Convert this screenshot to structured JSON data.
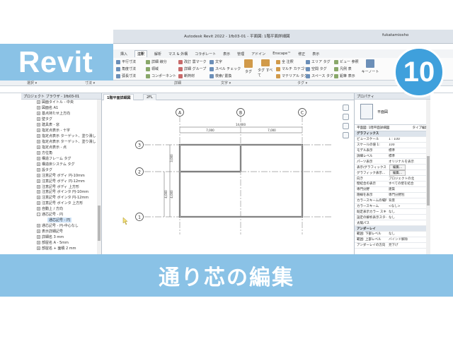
{
  "overlay": {
    "brand_label": "Revit",
    "episode_number": "10",
    "caption": "通り芯の編集"
  },
  "window": {
    "title": "Autodesk Revit 2022 - 1fb03-01 - 平面図: 1階平面詳細図",
    "user": "fukatamiosho"
  },
  "ribbon": {
    "tabs": [
      "挿入",
      "注釈",
      "解析",
      "マス & 外構",
      "コラボレート",
      "表示",
      "管理",
      "アドイン",
      "Enscape™",
      "修正",
      "表示"
    ],
    "active_tab_index": 1,
    "groups": {
      "dimension": [
        "平行寸法",
        "角度寸法",
        "弧長寸法"
      ],
      "detail": [
        "詳細 線分",
        "領域",
        "コンポーネント"
      ],
      "detail2": [
        "改訂 雲マーク",
        "詳細 グループ",
        "断熱材"
      ],
      "text": [
        "文字",
        "スペル チェック",
        "検索/ 置換"
      ],
      "tag": [
        "タグ",
        "タグ すべて"
      ],
      "tag2": [
        "全 注釈",
        "マルチ カテゴリ",
        "マテリアル タグ"
      ],
      "tag3": [
        "エリア タグ",
        "空間 タグ",
        "スペース タグ"
      ],
      "symbol": [
        "ビュー 参照",
        "凡例 表",
        "鉛筆 表示"
      ],
      "keynote": "キーノート"
    },
    "panel_labels": [
      "選択 ▾",
      "寸法 ▾",
      "詳細",
      "文字 ▾",
      "タグ ▾"
    ]
  },
  "project_browser": {
    "header": "プロジェクト ブラウザ - 1fb03-01",
    "items": [
      {
        "label": "図面タイトル - 中央",
        "expander": "+"
      },
      {
        "label": "図面名 A1",
        "expander": "+"
      },
      {
        "label": "基点持たせ上方向",
        "expander": "+"
      },
      {
        "label": "壁タグ",
        "expander": "+"
      },
      {
        "label": "建具表 - 窓",
        "expander": "+"
      },
      {
        "label": "指定点表示 - 十字",
        "expander": "+"
      },
      {
        "label": "指定点表示 ターゲット、塗り潰し",
        "expander": "+"
      },
      {
        "label": "指定点表示 ターゲット、塗り潰し",
        "expander": "+"
      },
      {
        "label": "指定点表示 - 点",
        "expander": "+"
      },
      {
        "label": "方位角",
        "expander": "+"
      },
      {
        "label": "構造フレーム タグ",
        "expander": "+"
      },
      {
        "label": "構造床システム タグ",
        "expander": "+"
      },
      {
        "label": "設タグ",
        "expander": "+"
      },
      {
        "label": "注意記号 ボディ 円-10mm",
        "expander": "+"
      },
      {
        "label": "注意記号 ボディ 円-12mm",
        "expander": "+"
      },
      {
        "label": "注意記号 ボディ 上方形",
        "expander": "+"
      },
      {
        "label": "注意記号 ボインタ 円-10mm",
        "expander": "+"
      },
      {
        "label": "注意記号 ボインタ 円-12mm",
        "expander": "+"
      },
      {
        "label": "注意記号 ボインタ 上方形",
        "expander": "+"
      },
      {
        "label": "自動上 / 方向",
        "expander": "+"
      },
      {
        "label": "通芯記号 - 円",
        "expander": "-"
      },
      {
        "label": "通芯記号 - 円",
        "expander": "",
        "selected": true
      },
      {
        "label": "通芯記号 - 円-中心なし",
        "expander": "+"
      },
      {
        "label": "表示詳細記号",
        "expander": "+"
      },
      {
        "label": "詳細名 3 mm",
        "expander": "+"
      },
      {
        "label": "部屋名 A - 5mm",
        "expander": "+"
      },
      {
        "label": "部屋名 + 面積 2 mm",
        "expander": "+"
      }
    ]
  },
  "view_tabs": [
    {
      "label": "1階平面詳細図",
      "active": true
    },
    {
      "label": "2FL",
      "active": false
    }
  ],
  "drawing": {
    "grid_columns": [
      "A",
      "B",
      "C"
    ],
    "grid_rows": [
      "3",
      "2",
      "1"
    ],
    "dim_total": "14,000",
    "dim_spans": [
      "7,000",
      "7,000"
    ],
    "dim_vertical": [
      "3,000",
      "4,000",
      "4,000"
    ]
  },
  "properties": {
    "header": "プロパティ",
    "type_name": "平面図",
    "filter_left": "平面図: 1階平面詳細図",
    "filter_right": "タイプ編集",
    "rows": [
      {
        "group": "グラフィックス"
      },
      {
        "key": "ビュースケール",
        "value": "1 : 100"
      },
      {
        "key": "スケールの値 1:",
        "value": "100"
      },
      {
        "key": "モデル表示",
        "value": "標準"
      },
      {
        "key": "詳細レベル",
        "value": "標準"
      },
      {
        "key": "パーツ表示",
        "value": "オリジナルを表示"
      },
      {
        "key": "表示/グラフィックス...",
        "value": "編集..."
      },
      {
        "key": "グラフィック表示...",
        "value": "編集..."
      },
      {
        "key": "向き",
        "value": "プロジェクトの北"
      },
      {
        "key": "壁結合の表示",
        "value": "すべての壁を結合"
      },
      {
        "key": "専門分野",
        "value": "建築"
      },
      {
        "key": "隠線を表示",
        "value": "専門分野別"
      },
      {
        "key": "カラースキームの場所",
        "value": "背景"
      },
      {
        "key": "カラースキーム",
        "value": "<なし>"
      },
      {
        "key": "既定表示カラー スキーム",
        "value": "なし"
      },
      {
        "key": "設定の解析表示スタイル",
        "value": "なし"
      },
      {
        "key": "太陽パス",
        "value": ""
      },
      {
        "group": "アンダーレイ"
      },
      {
        "key": "範囲: 下部レベル",
        "value": "なし"
      },
      {
        "key": "範囲: 上部レベル",
        "value": "バインド解除"
      },
      {
        "key": "アンダーレイの方向",
        "value": "見下げ"
      }
    ]
  },
  "colors": {
    "overlay_blue": "#8ac2e6",
    "badge_blue": "#3fa0dc",
    "grid_line": "#888888"
  }
}
